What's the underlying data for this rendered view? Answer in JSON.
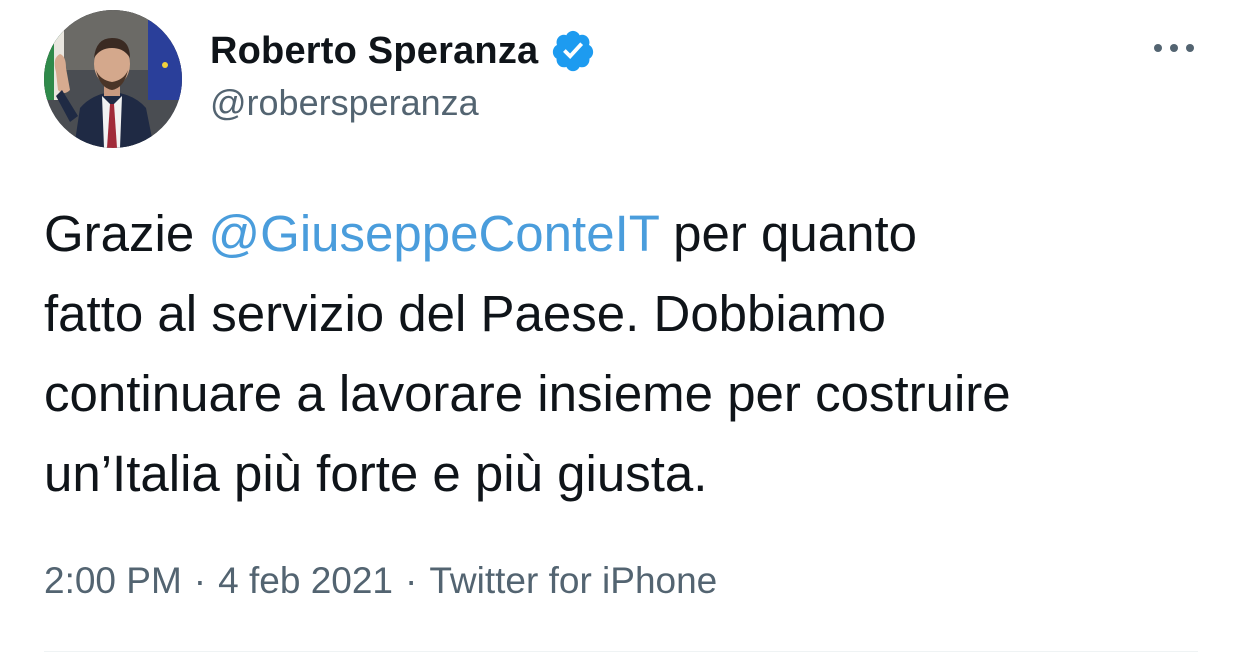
{
  "tweet": {
    "author": {
      "display_name": "Roberto Speranza",
      "handle": "@robersperanza",
      "verified": true,
      "avatar_icon": "profile-photo"
    },
    "more_icon": "more-horizontal-icon",
    "text": {
      "prefix": "Grazie ",
      "mention": "@GiuseppeConteIT",
      "suffix": " per quanto\nfatto al servizio del Paese. Dobbiamo\ncontinuare a lavorare insieme per costruire\nun’Italia più forte e più giusta."
    },
    "meta": {
      "time": "2:00 PM",
      "separator": "·",
      "date": "4 feb 2021",
      "source": "Twitter for iPhone"
    }
  },
  "colors": {
    "text": "#0f1419",
    "secondary": "#536471",
    "mention": "#4a9ddc",
    "verified_badge": "#1d9bf0"
  }
}
